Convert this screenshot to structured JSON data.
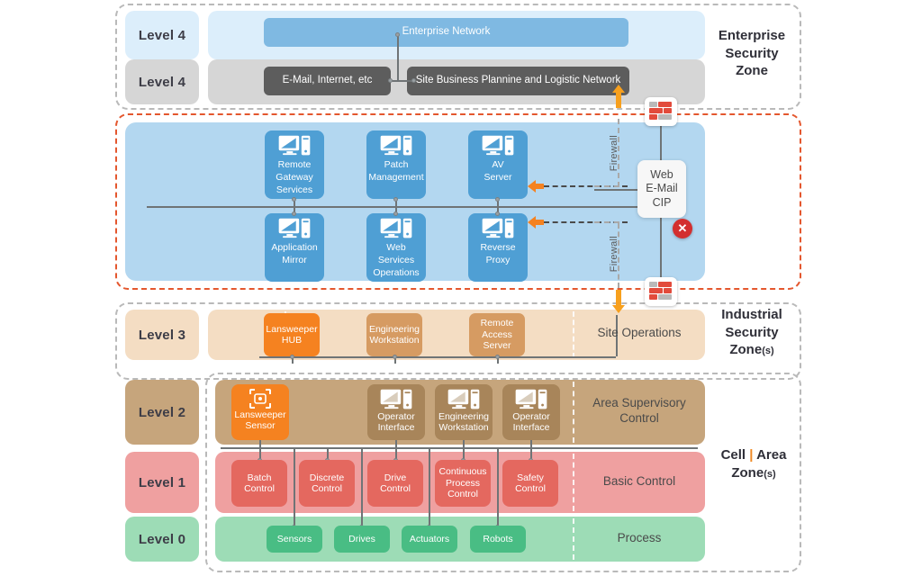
{
  "zones": {
    "enterprise": {
      "caption_line1": "Enterprise",
      "caption_line2": "Security",
      "caption_line3": "Zone"
    },
    "industrial": {
      "caption_line1": "Industrial",
      "caption_line2": "Security",
      "caption_line3": "Zone",
      "caption_sub": "(s)"
    },
    "cell": {
      "caption_left": "Cell",
      "separator": "|",
      "caption_right": "Area",
      "caption_line2": "Zone",
      "caption_sub": "(s)"
    }
  },
  "levels": {
    "l4_top": "Level 4",
    "l4_bottom": "Level 4",
    "l3": "Level 3",
    "l2": "Level 2",
    "l1": "Level 1",
    "l0": "Level 0"
  },
  "enterprise_band": {
    "network": "Enterprise Network",
    "email": "E-Mail, Internet, etc",
    "business": "Site Business Plannine and Logistic Network"
  },
  "dmz": {
    "servers_top": [
      {
        "line1": "Remote",
        "line2": "Gateway",
        "line3": "Services"
      },
      {
        "line1": "Patch",
        "line2": "Management",
        "line3": ""
      },
      {
        "line1": "AV",
        "line2": "Server",
        "line3": ""
      }
    ],
    "servers_bottom": [
      {
        "line1": "Application",
        "line2": "Mirror",
        "line3": ""
      },
      {
        "line1": "Web",
        "line2": "Services",
        "line3": "Operations"
      },
      {
        "line1": "Reverse",
        "line2": "Proxy",
        "line3": ""
      }
    ],
    "webmail": {
      "line1": "Web",
      "line2": "E-Mail",
      "line3": "CIP"
    },
    "blocked_badge": "✕",
    "firewall_label_upper": "Firewall",
    "firewall_label_lower": "Firewall"
  },
  "level3": {
    "chips": [
      {
        "line1": "Lansweeper",
        "line2": "HUB",
        "highlight": true
      },
      {
        "line1": "Engineering",
        "line2": "Workstation",
        "highlight": false
      },
      {
        "line1": "Remote",
        "line2": "Access",
        "line3": "Server",
        "highlight": false
      }
    ],
    "caption": "Site Operations"
  },
  "level2": {
    "chips": [
      {
        "line1": "Lansweeper",
        "line2": "Sensor",
        "highlight": true
      },
      {
        "line1": "Operator",
        "line2": "Interface",
        "highlight": false
      },
      {
        "line1": "Engineering",
        "line2": "Workstation",
        "highlight": false
      },
      {
        "line1": "Operator",
        "line2": "Interface",
        "highlight": false
      }
    ],
    "caption_line1": "Area Supervisory",
    "caption_line2": "Control"
  },
  "level1": {
    "chips": [
      {
        "line1": "Batch",
        "line2": "Control"
      },
      {
        "line1": "Discrete",
        "line2": "Control"
      },
      {
        "line1": "Drive",
        "line2": "Control"
      },
      {
        "line1": "Continuous",
        "line2": "Process",
        "line3": "Control"
      },
      {
        "line1": "Safety",
        "line2": "Control"
      }
    ],
    "caption": "Basic Control"
  },
  "level0": {
    "chips": [
      {
        "label": "Sensors"
      },
      {
        "label": "Drives"
      },
      {
        "label": "Actuators"
      },
      {
        "label": "Robots"
      }
    ],
    "caption": "Process"
  },
  "colors": {
    "dmz_border": "#e4572e",
    "highlight_orange": "#f58220",
    "blocked_red": "#d32f2f",
    "enterprise_blue": "#7fb9e2",
    "level2_brown": "#c6a57c",
    "level1_red": "#efa0a0",
    "level0_green": "#9ddcb6"
  }
}
